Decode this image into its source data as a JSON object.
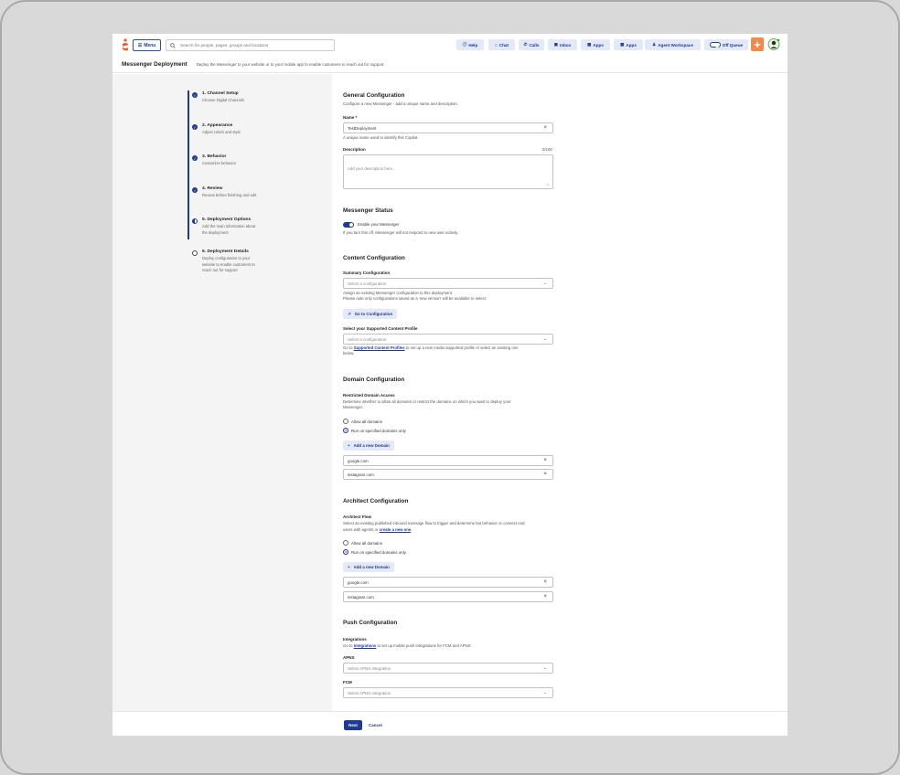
{
  "topbar": {
    "menu_label": "Menu",
    "search_placeholder": "Search for people, pages, groups and locations",
    "nav": [
      {
        "label": "Help",
        "icon": "help-icon"
      },
      {
        "label": "Chat",
        "icon": "chat-icon"
      },
      {
        "label": "Calls",
        "icon": "phone-icon"
      },
      {
        "label": "Inbox",
        "icon": "inbox-icon"
      },
      {
        "label": "Apps",
        "icon": "apps-icon"
      },
      {
        "label": "Apps",
        "icon": "apps-icon"
      },
      {
        "label": "Agent Workspace",
        "icon": "agent-icon"
      },
      {
        "label": "Off Queue",
        "icon": "toggle-icon"
      }
    ]
  },
  "page": {
    "title": "Messenger Deployment",
    "description": "Deploy the Messenger to your website or to your mobile app to enable customers to reach out for support."
  },
  "stepper": [
    {
      "label": "1. Channel Setup",
      "sub": "Choose Digital Channels",
      "state": "done"
    },
    {
      "label": "2. Appearance",
      "sub": "Adjust colors and style",
      "state": "done"
    },
    {
      "label": "3. Behavior",
      "sub": "Customize behavior",
      "state": "done"
    },
    {
      "label": "4. Review",
      "sub": "Review before finishing and edit",
      "state": "done"
    },
    {
      "label": "5. Deployment Options",
      "sub": "Add the main information about the deployment",
      "state": "current"
    },
    {
      "label": "6. Deployment Details",
      "sub": "Deploy configuration to your website to enable customers to reach out for support",
      "state": "pending"
    }
  ],
  "general": {
    "title": "General Configuration",
    "desc": "Configure a new Messenger - add a unique name and description.",
    "name_label": "Name *",
    "name_value": "TestDeployment",
    "name_help": "A unique name used to identify this Copilot.",
    "desc_label": "Description",
    "desc_count": "0/100",
    "desc_placeholder": "Add your description here..."
  },
  "status": {
    "title": "Messenger Status",
    "toggle_label": "Enable your Messenger",
    "toggle_help": "If you turn this off, Messenger will not respond to new user activity."
  },
  "content": {
    "title": "Content Configuration",
    "summary_label": "Summary Configuration",
    "summary_placeholder": "Select a configuration",
    "summary_help1": "Assign an existing Messenger configuration to this deployment.",
    "summary_help2": "Please note only configurations saved as a 'new version' will be available to select.",
    "goto_button": "Go to Configuration",
    "profile_label": "Select your Supported Content Profile",
    "profile_placeholder": "Select a configuration",
    "profile_help_pre": "Go to ",
    "profile_help_link": "Supported Content Profiles",
    "profile_help_post": " to set up a new media supported profile or select an existing one",
    "profile_help_line2": "below."
  },
  "domain": {
    "title": "Domain Configuration",
    "label": "Restricted Domain Access",
    "desc1": "Determine whether to allow all domains or restrict the domains on which you want to deploy your",
    "desc2": "Messenger.",
    "opt_all": "Allow all domains",
    "opt_specified": "Run on specified domains only",
    "add_button": "Add a new Domain",
    "domains": [
      "google.com",
      "instagram.com"
    ]
  },
  "architect": {
    "title": "Architect Configuration",
    "label": "Architect Flow",
    "desc1": "Select an existing published inbound message flow to trigger and determine bot behavior or connect end",
    "desc2_pre": "users with agents or ",
    "desc2_link": "create a new one",
    "desc2_post": ".",
    "opt_all": "Allow all domains",
    "opt_specified": "Run on specified domains only",
    "add_button": "Add a new Domain",
    "domains": [
      "google.com",
      "instagram.com"
    ]
  },
  "push": {
    "title": "Push Configuration",
    "label": "Integrations",
    "desc_pre": "Go to ",
    "desc_link": "Integrations",
    "desc_post": " to set up mobile push integrations for FCM and APNS",
    "apns_label": "APNS",
    "apns_placeholder": "Select APNS Integration",
    "fcm_label": "FCM",
    "fcm_placeholder": "Select APNS Integration"
  },
  "footer": {
    "next": "Next",
    "cancel": "Cancel"
  },
  "colors": {
    "accent": "#1f3a93",
    "accent_light": "#e4e9f8",
    "left_pane": "#f4f4f4",
    "brand_orange": "#f05a28"
  }
}
